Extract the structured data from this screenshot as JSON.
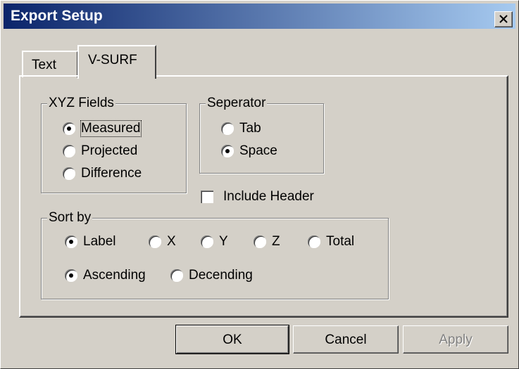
{
  "window": {
    "title": "Export Setup"
  },
  "tabs": [
    {
      "label": "Text"
    },
    {
      "label": "V-SURF"
    }
  ],
  "xyz_fields": {
    "legend": "XYZ Fields",
    "options": [
      {
        "label": "Measured",
        "selected": true
      },
      {
        "label": "Projected",
        "selected": false
      },
      {
        "label": "Difference",
        "selected": false
      }
    ]
  },
  "separator": {
    "legend": "Seperator",
    "options": [
      {
        "label": "Tab",
        "selected": false
      },
      {
        "label": "Space",
        "selected": true
      }
    ]
  },
  "include_header": {
    "label": "Include Header",
    "checked": false
  },
  "sort_by": {
    "legend": "Sort by",
    "fields": [
      {
        "label": "Label",
        "selected": true
      },
      {
        "label": "X",
        "selected": false
      },
      {
        "label": "Y",
        "selected": false
      },
      {
        "label": "Z",
        "selected": false
      },
      {
        "label": "Total",
        "selected": false
      }
    ],
    "order": [
      {
        "label": "Ascending",
        "selected": true
      },
      {
        "label": "Decending",
        "selected": false
      }
    ]
  },
  "buttons": {
    "ok": "OK",
    "cancel": "Cancel",
    "apply": "Apply"
  }
}
